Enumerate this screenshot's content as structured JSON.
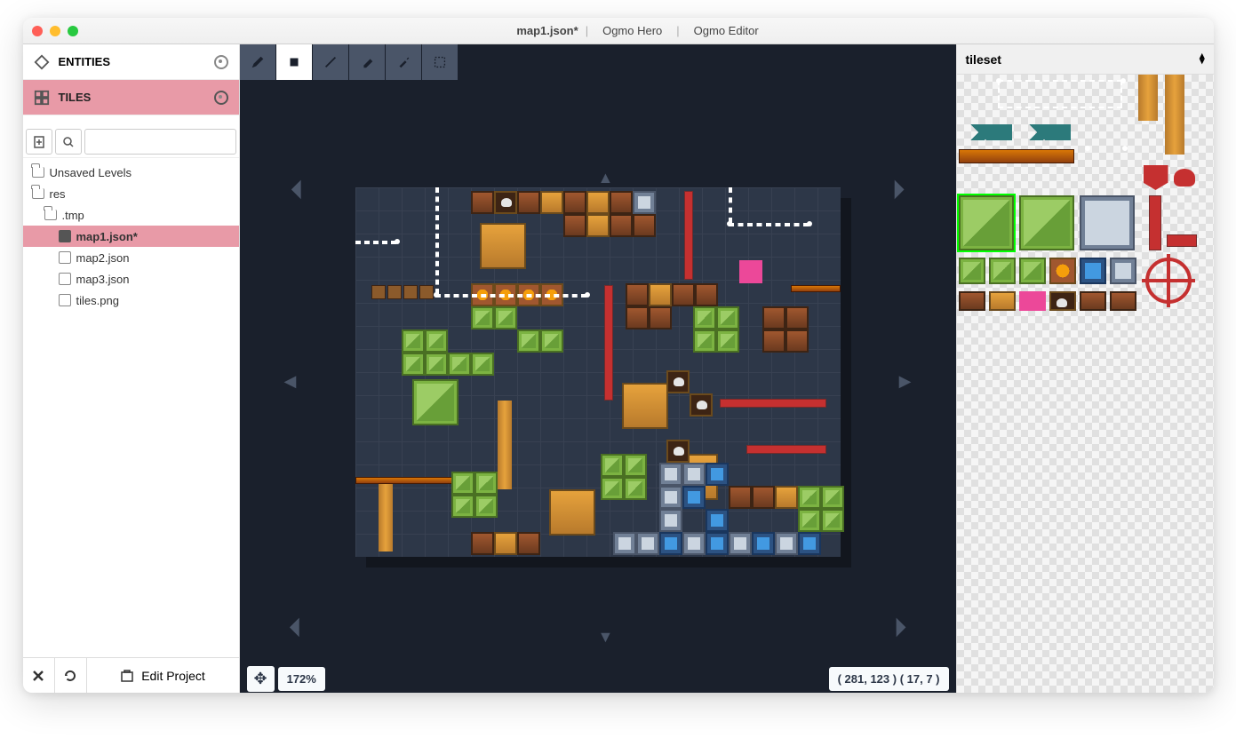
{
  "window": {
    "file": "map1.json*",
    "project": "Ogmo Hero",
    "app": "Ogmo Editor"
  },
  "layers": {
    "entities": "ENTITIES",
    "tiles": "TILES"
  },
  "files": {
    "unsaved": "Unsaved Levels",
    "res": "res",
    "tmp": ".tmp",
    "map1": "map1.json*",
    "map2": "map2.json",
    "map3": "map3.json",
    "tiles_png": "tiles.png"
  },
  "edit_project": "Edit Project",
  "status": {
    "zoom": "172%",
    "coords": "( 281, 123 ) ( 17, 7 )"
  },
  "right_panel": {
    "title": "tileset"
  },
  "tools": [
    "pencil",
    "fill",
    "line",
    "eraser",
    "eyedropper",
    "select"
  ]
}
